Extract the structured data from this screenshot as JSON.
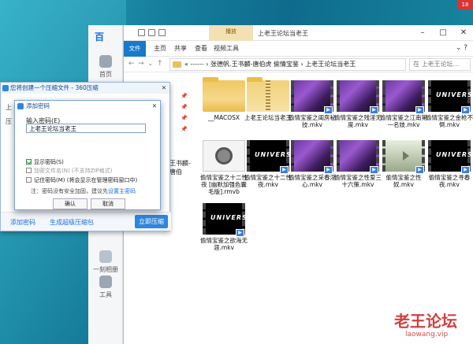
{
  "notification_badge": "18",
  "app360": {
    "logo": "百",
    "nav": [
      {
        "label": "首页",
        "icon": "home-icon"
      },
      {
        "label": "一刻相册",
        "icon": "album-icon"
      },
      {
        "label": "工具",
        "icon": "tools-icon"
      }
    ]
  },
  "explorer": {
    "title": "上老王论坛当老王",
    "context_tab": "播放",
    "ribbon_tabs": [
      "文件",
      "主页",
      "共享",
      "查看",
      "视频工具"
    ],
    "address_segments": "« ------ › 张德帆.王书麟-唐伯虎 偷情宝鉴 › 上老王论坛当老王",
    "search_placeholder": "在 上老王论坛...",
    "sidebar_label": "王书麟-唐伯",
    "files": [
      {
        "name": "__MACOSX",
        "kind": "folder"
      },
      {
        "name": "上老王论坛当老王",
        "kind": "zipfolder"
      },
      {
        "name": "偷情宝鉴之闺房秘技.mkv",
        "kind": "video-purple"
      },
      {
        "name": "偷情宝鉴之残淫无度.mkv",
        "kind": "video-purple"
      },
      {
        "name": "偷情宝鉴之江南第一名妓.mkv",
        "kind": "video-purple"
      },
      {
        "name": "偷情宝鉴之金枪不倒.mkv",
        "kind": "video-black"
      },
      {
        "name": "偷情宝鉴之十二性夜 [幽默加强色囊毛版].rmvb",
        "kind": "rmvb"
      },
      {
        "name": "偷情宝鉴之十二性夜.mkv",
        "kind": "video-black"
      },
      {
        "name": "偷情宝鉴之采春淫心.mkv",
        "kind": "video-purple"
      },
      {
        "name": "偷情宝鉴之性爱三十六策.mkv",
        "kind": "video-purple"
      },
      {
        "name": "偷情宝鉴之性奴.mkv",
        "kind": "video-green"
      },
      {
        "name": "偷情宝鉴之寻春夜.mkv",
        "kind": "video-black"
      },
      {
        "name": "偷情宝鉴之欲海无涯.mkv",
        "kind": "video-black"
      }
    ],
    "thumb_text": "UNIVERSE"
  },
  "compress_dialog": {
    "title": "您将创建一个压缩文件 - 360压缩",
    "left_labels": [
      "上",
      "压"
    ],
    "footer_add_password": "添加密码",
    "footer_self_extract": "生成超级压缩包",
    "start_button": "立即压缩"
  },
  "password_dialog": {
    "title": "添加密码",
    "input_label": "输入密码(E)",
    "password_value": "上老王论坛当老王",
    "opt_show": "显示密码(S)",
    "opt_encrypt_names": "加密文件名(N) (不支持ZIP格式)",
    "opt_remember": "记住密码(M) (将会显示在管理密码窗口中)",
    "note_prefix": "注：密码没有安全加固，建议先",
    "note_link": "设置主密码",
    "ok": "确认",
    "cancel": "取消"
  },
  "watermark": {
    "title": "老王论坛",
    "url": "laowang.vip"
  }
}
